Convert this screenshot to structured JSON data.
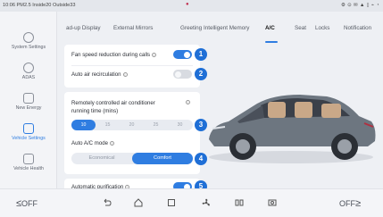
{
  "status_bar": {
    "left_text": "10:06 PM2.5 Inside20 Outside33",
    "center_icon": "location-pin-icon",
    "right_text": "⚙ ⊙ ✉ ▲ ▯ ⌁ ◔"
  },
  "sidebar": {
    "items": [
      {
        "label": "System Settings",
        "icon": "settings-icon",
        "active": false
      },
      {
        "label": "ADAS",
        "icon": "adas-icon",
        "active": false
      },
      {
        "label": "New Energy",
        "icon": "new-energy-icon",
        "active": false
      },
      {
        "label": "Vehicle Settings",
        "icon": "vehicle-settings-icon",
        "active": true
      },
      {
        "label": "Vehicle Health",
        "icon": "vehicle-health-icon",
        "active": false
      }
    ]
  },
  "tabs": [
    {
      "label": "ad-up Display",
      "active": false
    },
    {
      "label": "External Mirrors",
      "active": false
    },
    {
      "label": "Greeting",
      "active": false
    },
    {
      "label": "Intelligent Memory",
      "active": false
    },
    {
      "label": "A/C",
      "active": true
    },
    {
      "label": "Seat",
      "active": false
    },
    {
      "label": "Locks",
      "active": false
    },
    {
      "label": "Notification",
      "active": false
    }
  ],
  "settings": {
    "fan_speed": {
      "label": "Fan speed reduction during calls",
      "on": true,
      "badge": "1"
    },
    "auto_air": {
      "label": "Auto air recirculation",
      "on": false,
      "badge": "2"
    },
    "remote_ac": {
      "label_line1": "Remotely controlled air conditioner",
      "label_line2": "running time (mins)",
      "badge": "3",
      "options": [
        "10",
        "15",
        "20",
        "25",
        "30"
      ],
      "selected_index": 0
    },
    "auto_ac_mode": {
      "label": "Auto A/C mode",
      "badge": "4",
      "options": [
        "Economical",
        "Comfort"
      ],
      "selected_index": 1
    },
    "auto_purification": {
      "label": "Automatic purification",
      "on": true,
      "badge": "5"
    }
  },
  "bottom_bar": {
    "left_temp": "OFF",
    "right_temp": "OFF",
    "icons": [
      "back-icon",
      "home-icon",
      "square-icon",
      "fan-icon",
      "seat-heat-icon",
      "camera-icon"
    ]
  },
  "colors": {
    "accent": "#2f7de1",
    "badge": "#1f6fd6",
    "car_body": "#6d7680"
  }
}
